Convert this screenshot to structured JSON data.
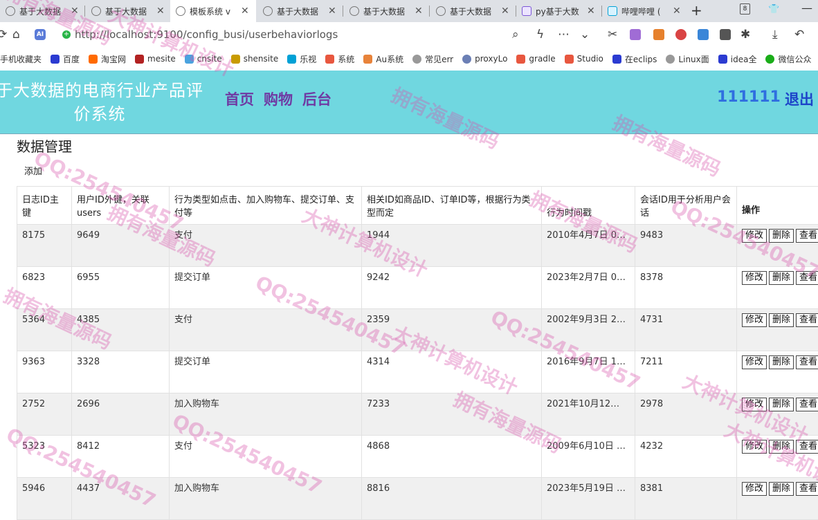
{
  "browser": {
    "tabs": [
      {
        "title": "基于大数据",
        "icon": "globe-icon"
      },
      {
        "title": "基于大数据",
        "icon": "globe-icon"
      },
      {
        "title": "模板系统 v",
        "icon": "globe-icon",
        "active": true
      },
      {
        "title": "基于大数据",
        "icon": "globe-icon"
      },
      {
        "title": "基于大数据",
        "icon": "globe-icon"
      },
      {
        "title": "基于大数据",
        "icon": "globe-icon"
      },
      {
        "title": "py基于大数",
        "icon": "video-icon"
      },
      {
        "title": "哔哩哔哩 (",
        "icon": "bilibili-icon"
      }
    ],
    "tab_count": "8",
    "url": "http://localhost:9100/config_busi/userbehaviorlogs",
    "bookmarks": [
      "手机收藏夹",
      "百度",
      "淘宝网",
      "mesite",
      "cnsite",
      "shensite",
      "乐视",
      "系统",
      "Au系统",
      "常见err",
      "proxyLo",
      "gradle",
      "Studio",
      "在eclips",
      "Linux面",
      "idea全",
      "微信公众"
    ]
  },
  "app": {
    "title": "于大数据的电商行业产品评价系统",
    "nav": [
      "首页",
      "购物",
      "后台"
    ],
    "user": "111111",
    "logout": "退出"
  },
  "page": {
    "title": "数据管理",
    "add_label": "添加",
    "columns": [
      "日志ID主键",
      "用户ID外键，关联users",
      "行为类型如点击、加入购物车、提交订单、支付等",
      "相关ID如商品ID、订单ID等，根据行为类型而定",
      "行为时间戳",
      "会话ID用于分析用户会话",
      "操作"
    ],
    "buttons": {
      "edit": "修改",
      "delete": "删除",
      "view": "查看"
    },
    "rows": [
      [
        "8175",
        "9649",
        "支付",
        "1944",
        "2010年4月7日 0…",
        "9483"
      ],
      [
        "6823",
        "6955",
        "提交订单",
        "9242",
        "2023年2月7日 0…",
        "8378"
      ],
      [
        "5364",
        "4385",
        "支付",
        "2359",
        "2002年9月3日 2…",
        "4731"
      ],
      [
        "9363",
        "3328",
        "提交订单",
        "4314",
        "2016年9月7日 1…",
        "7211"
      ],
      [
        "2752",
        "2696",
        "加入购物车",
        "7233",
        "2021年10月12…",
        "2978"
      ],
      [
        "5323",
        "8412",
        "支付",
        "4868",
        "2009年6月10日 …",
        "4232"
      ],
      [
        "5946",
        "4437",
        "加入购物车",
        "8816",
        "2023年5月19日 …",
        "8381"
      ]
    ]
  },
  "watermarks": [
    "QQ:254540457",
    "大神计算机设计",
    "拥有海量源码"
  ]
}
